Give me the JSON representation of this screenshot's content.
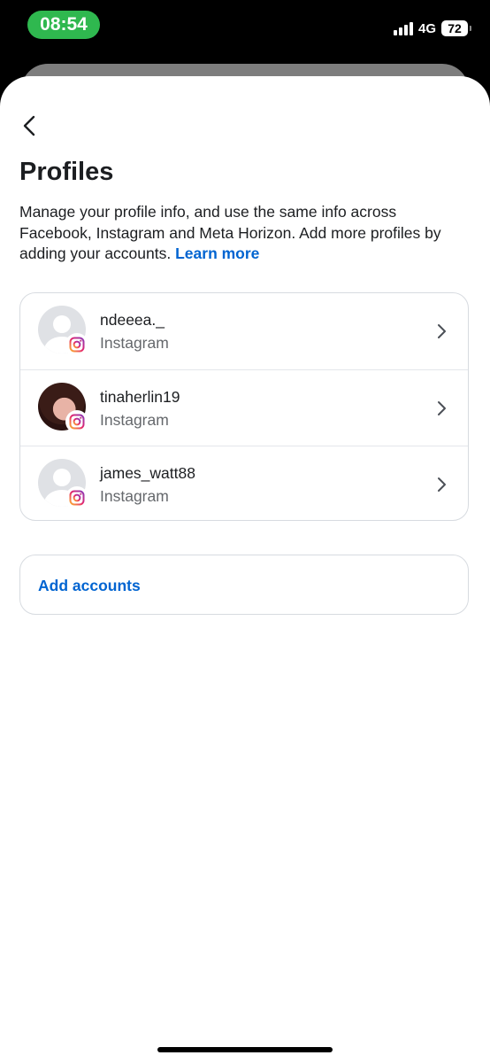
{
  "status_bar": {
    "time": "08:54",
    "network": "4G",
    "battery": "72"
  },
  "header": {
    "title": "Profiles",
    "description": "Manage your profile info, and use the same info across Facebook, Instagram and Meta Horizon. Add more profiles by adding your accounts.",
    "learn_more": "Learn more"
  },
  "profiles": [
    {
      "name": "ndeeea._",
      "source": "Instagram",
      "avatar": "placeholder"
    },
    {
      "name": "tinaherlin19",
      "source": "Instagram",
      "avatar": "photo"
    },
    {
      "name": "james_watt88",
      "source": "Instagram",
      "avatar": "placeholder"
    }
  ],
  "add_accounts": {
    "label": "Add accounts"
  },
  "colors": {
    "accent": "#0064d1",
    "status_pill": "#2fb84f"
  }
}
